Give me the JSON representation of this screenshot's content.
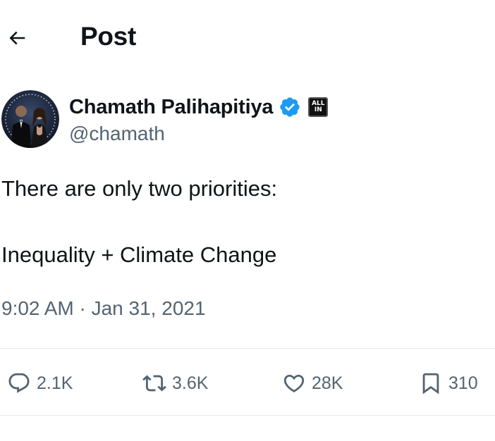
{
  "header": {
    "title": "Post",
    "back_icon": "arrow-left-icon"
  },
  "author": {
    "display_name": "Chamath Palihapitiya",
    "handle": "@chamath",
    "verified_icon": "verified-badge-icon",
    "verified_color": "#1d9bf0",
    "affiliate_badge": {
      "line1": "ALL",
      "line2": "IN"
    }
  },
  "tweet": {
    "lines": [
      "There are only two priorities:",
      "Inequality + Climate Change"
    ],
    "timestamp": "9:02 AM · Jan 31, 2021"
  },
  "actions": {
    "reply": {
      "icon": "reply-icon",
      "count": "2.1K"
    },
    "repost": {
      "icon": "repost-icon",
      "count": "3.6K"
    },
    "like": {
      "icon": "heart-icon",
      "count": "28K"
    },
    "bookmark": {
      "icon": "bookmark-icon",
      "count": "310"
    }
  },
  "colors": {
    "text_primary": "#0f1419",
    "text_secondary": "#536471",
    "divider": "#e7e9ea"
  }
}
